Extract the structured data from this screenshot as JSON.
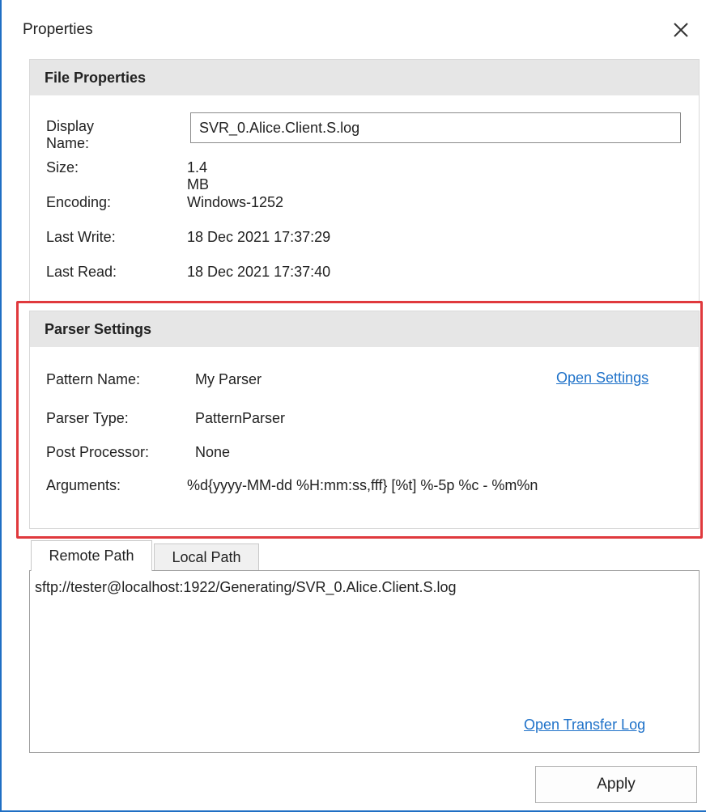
{
  "window": {
    "title": "Properties"
  },
  "file_properties": {
    "header": "File Properties",
    "display_name_label": "Display Name:",
    "display_name_value": "SVR_0.Alice.Client.S.log",
    "size_label": "Size:",
    "size_value": "1.4 MB",
    "encoding_label": "Encoding:",
    "encoding_value": "Windows-1252",
    "last_write_label": "Last Write:",
    "last_write_value": "18 Dec 2021 17:37:29",
    "last_read_label": "Last Read:",
    "last_read_value": "18 Dec 2021 17:37:40"
  },
  "parser_settings": {
    "header": "Parser Settings",
    "pattern_name_label": "Pattern Name:",
    "pattern_name_value": "My Parser",
    "open_settings_link": "Open Settings",
    "parser_type_label": "Parser Type:",
    "parser_type_value": "PatternParser",
    "post_processor_label": "Post Processor:",
    "post_processor_value": "None",
    "arguments_label": "Arguments:",
    "arguments_value": "%d{yyyy-MM-dd %H:mm:ss,fff} [%t] %-5p %c - %m%n",
    "highlight_color": "#e0393d"
  },
  "tabs": {
    "remote_path_label": "Remote Path",
    "local_path_label": "Local Path",
    "remote_path_value": "sftp://tester@localhost:1922/Generating/SVR_0.Alice.Client.S.log",
    "open_transfer_log_link": "Open Transfer Log"
  },
  "buttons": {
    "apply_label": "Apply"
  },
  "icons": {
    "close": "close-icon"
  },
  "colors": {
    "link": "#1f72c9",
    "window_border": "#1f6fc4",
    "header_bg": "#e6e6e6"
  }
}
